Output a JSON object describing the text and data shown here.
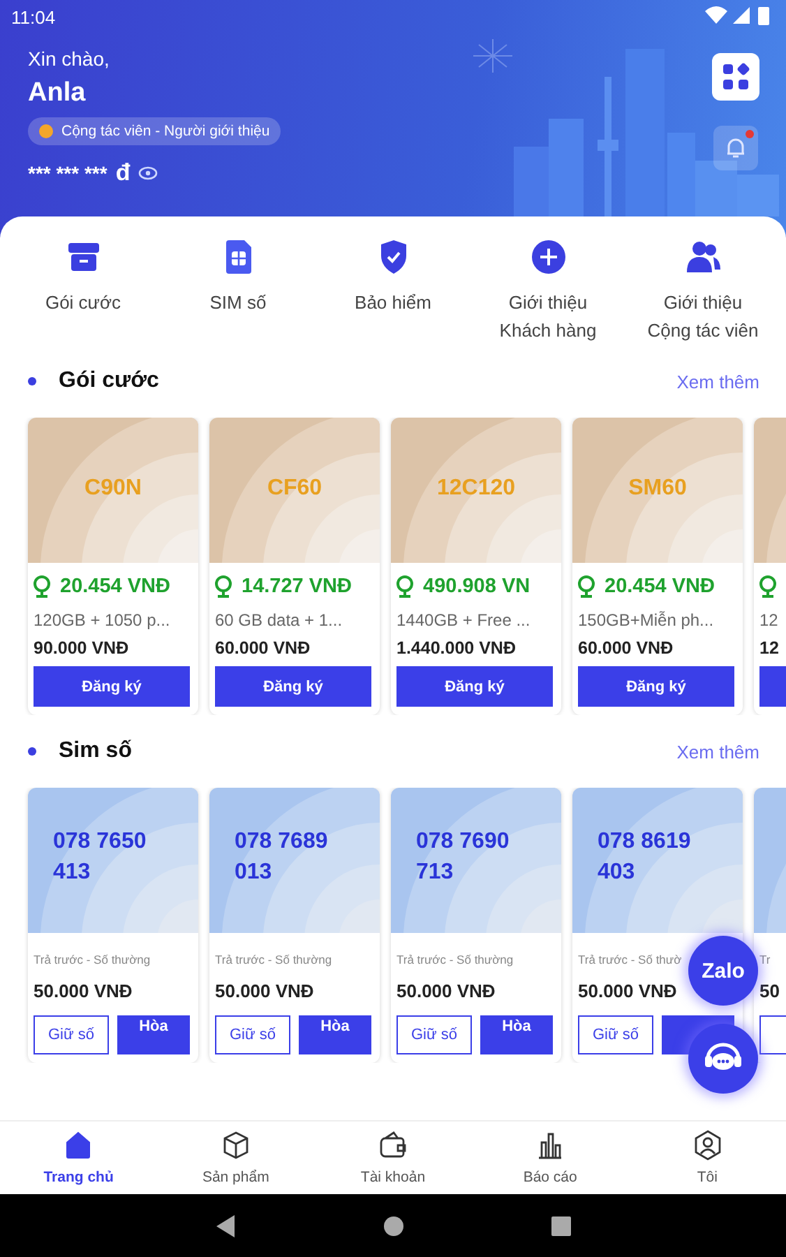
{
  "status_bar": {
    "time": "11:04"
  },
  "header": {
    "greeting": "Xin chào,",
    "name": "Anla",
    "role": "Cộng tác viên - Người giới thiệu",
    "balance": "*** *** ***",
    "currency": "đ",
    "notification_dot": true
  },
  "quick_menu": [
    {
      "label": "Gói cước"
    },
    {
      "label": "SIM số"
    },
    {
      "label": "Bảo hiểm"
    },
    {
      "label": "Giới thiệu\nKhách hàng"
    },
    {
      "label": "Giới thiệu\nCộng tác viên"
    }
  ],
  "plans": {
    "title": "Gói cước",
    "more": "Xem thêm",
    "cards": [
      {
        "code": "C90N",
        "bonus": "20.454 VNĐ",
        "desc": "120GB + 1050 p...",
        "price": "90.000 VNĐ",
        "button": "Đăng ký"
      },
      {
        "code": "CF60",
        "bonus": "14.727 VNĐ",
        "desc": "60 GB data + 1...",
        "price": "60.000 VNĐ",
        "button": "Đăng ký"
      },
      {
        "code": "12C120",
        "bonus": "490.908 VN",
        "desc": "1440GB + Free ...",
        "price": "1.440.000 VNĐ",
        "button": "Đăng ký"
      },
      {
        "code": "SM60",
        "bonus": "20.454 VNĐ",
        "desc": "150GB+Miễn ph...",
        "price": "60.000 VNĐ",
        "button": "Đăng ký"
      },
      {
        "desc": "12",
        "price": "12"
      }
    ]
  },
  "sims": {
    "title": "Sim số",
    "more": "Xem thêm",
    "cards": [
      {
        "number": "078 7650\n413",
        "type": "Trả trước - Số thường",
        "price": "50.000 VNĐ",
        "hold": "Giữ số",
        "activate": "Hòa"
      },
      {
        "number": "078 7689\n013",
        "type": "Trả trước - Số thường",
        "price": "50.000 VNĐ",
        "hold": "Giữ số",
        "activate": "Hòa"
      },
      {
        "number": "078 7690\n713",
        "type": "Trả trước - Số thường",
        "price": "50.000 VNĐ",
        "hold": "Giữ số",
        "activate": "Hòa"
      },
      {
        "number": "078 8619\n403",
        "type": "Trả trước - Số thườ",
        "price": "50.000 VNĐ",
        "hold": "Giữ số"
      },
      {
        "type": "Tr",
        "price": "50"
      }
    ]
  },
  "floating": {
    "zalo": "Zalo"
  },
  "bottom_nav": [
    {
      "label": "Trang chủ",
      "selected": true
    },
    {
      "label": "Sản phẩm",
      "selected": false
    },
    {
      "label": "Tài khoản",
      "selected": false
    },
    {
      "label": "Báo cáo",
      "selected": false
    },
    {
      "label": "Tôi",
      "selected": false
    }
  ]
}
